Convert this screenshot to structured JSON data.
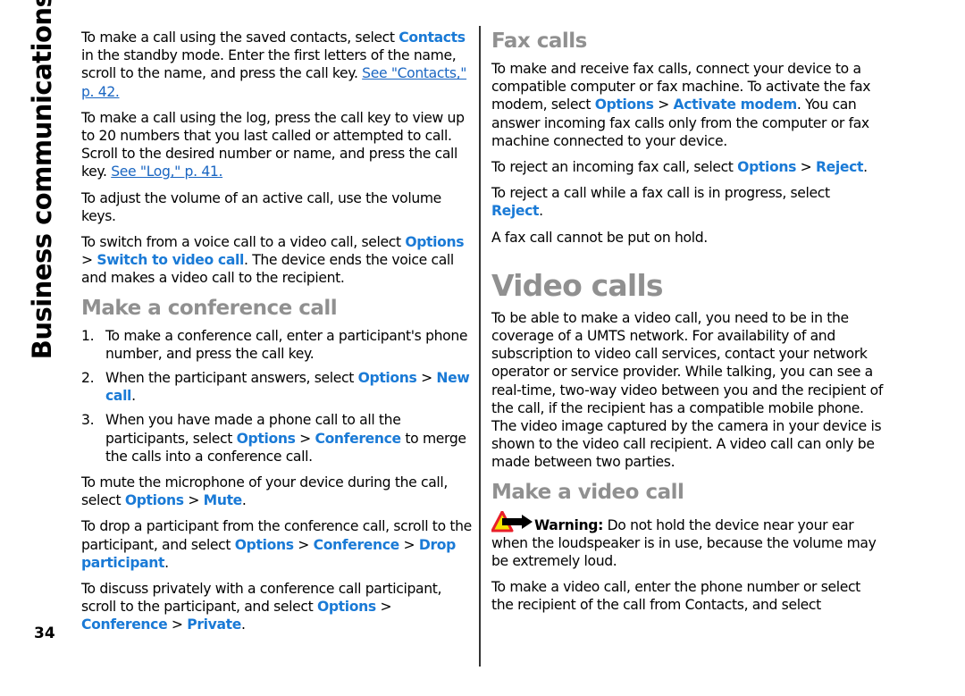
{
  "page": {
    "section_title": "Business communications",
    "page_number": "34"
  },
  "left_column": {
    "p1": {
      "t1": "To make a call using the saved contacts, select ",
      "hl1": "Contacts",
      "t2": " in the standby mode. Enter the first letters of the name, scroll to the name, and press the call key. ",
      "link": "See \"Contacts,\" p. 42."
    },
    "p2": {
      "t1": "To make a call using the log, press the call key to view up to 20 numbers that you last called or attempted to call. Scroll to the desired number or name, and press the call key. ",
      "link": "See \"Log,\" p. 41."
    },
    "p3": {
      "t1": "To adjust the volume of an active call, use the volume keys."
    },
    "p4": {
      "t1": "To switch from a voice call to a video call, select ",
      "hl1": "Options",
      "sep": " > ",
      "hl2": "Switch to video call",
      "t2": ". The device ends the voice call and makes a video call to the recipient."
    },
    "conference_heading": "Make a conference call",
    "steps": [
      {
        "num": "1.",
        "t1": "To make a conference call, enter a participant's phone number, and press the call key."
      },
      {
        "num": "2.",
        "t1": "When the participant answers, select ",
        "hl1": "Options",
        "sep": "  > ",
        "hl2": "New call",
        "t2": "."
      },
      {
        "num": "3.",
        "t1": "When you have made a phone call to all the participants, select ",
        "hl1": "Options",
        "sep": " > ",
        "hl2": "Conference",
        "t2": " to merge the calls into a conference call."
      }
    ],
    "p5": {
      "t1": "To mute the microphone of your device during the call, select ",
      "hl1": "Options",
      "sep": " > ",
      "hl2": "Mute",
      "t2": "."
    },
    "p6": {
      "t1": "To drop a participant from the conference call, scroll to the participant, and select ",
      "hl1": "Options",
      "sep1": " > ",
      "hl2": "Conference",
      "sep2": " > ",
      "hl3": "Drop participant",
      "t2": "."
    },
    "p7": {
      "t1": "To discuss privately with a conference call participant, scroll to the participant, and select ",
      "hl1": "Options",
      "sep1": " > ",
      "hl2": "Conference",
      "sep2": " > ",
      "hl3": "Private",
      "t2": "."
    }
  },
  "right_column": {
    "fax_heading": "Fax calls",
    "p1": {
      "t1": "To make and receive fax calls, connect your device to a compatible computer or fax machine. To activate the fax modem, select ",
      "hl1": "Options",
      "sep": " > ",
      "hl2": "Activate modem",
      "t2": ". You can answer incoming fax calls only from the computer or fax machine connected to your device."
    },
    "p2": {
      "t1": "To reject an incoming fax call, select ",
      "hl1": "Options",
      "sep": " > ",
      "hl2": "Reject",
      "t2": "."
    },
    "p3": {
      "t1": "To reject a call while a fax call is in progress, select ",
      "hl1": "Reject",
      "t2": "."
    },
    "p4": {
      "t1": "A fax call cannot be put on hold."
    },
    "video_heading": "Video calls",
    "p5": {
      "t1": "To be able to make a video call, you need to be in the coverage of a UMTS network. For availability of and subscription to video call services, contact your network operator or service provider. While talking, you can see a real-time, two-way video between you and the recipient of the call, if the recipient has a compatible mobile phone. The video image captured by the camera in your device is shown to the video call recipient. A video call can only be made between two parties."
    },
    "make_video_heading": "Make a video call",
    "warning": {
      "icon": "warning-icon",
      "label": "Warning:",
      "text": "  Do not hold the device near your ear when the loudspeaker is in use, because the volume may be extremely loud."
    },
    "p6": {
      "t1": "To make a video call, enter the phone number or select the recipient of the call from Contacts, and select"
    }
  },
  "colors": {
    "highlight": "#1a7ad6",
    "link": "#1a66c2",
    "heading_gray": "#909090"
  }
}
